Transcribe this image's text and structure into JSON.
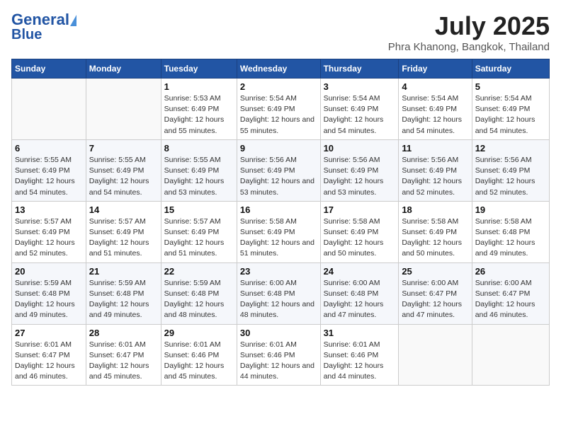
{
  "logo": {
    "line1": "General",
    "line2": "Blue"
  },
  "title": "July 2025",
  "subtitle": "Phra Khanong, Bangkok, Thailand",
  "days_of_week": [
    "Sunday",
    "Monday",
    "Tuesday",
    "Wednesday",
    "Thursday",
    "Friday",
    "Saturday"
  ],
  "weeks": [
    [
      {
        "day": "",
        "info": ""
      },
      {
        "day": "",
        "info": ""
      },
      {
        "day": "1",
        "info": "Sunrise: 5:53 AM\nSunset: 6:49 PM\nDaylight: 12 hours and 55 minutes."
      },
      {
        "day": "2",
        "info": "Sunrise: 5:54 AM\nSunset: 6:49 PM\nDaylight: 12 hours and 55 minutes."
      },
      {
        "day": "3",
        "info": "Sunrise: 5:54 AM\nSunset: 6:49 PM\nDaylight: 12 hours and 54 minutes."
      },
      {
        "day": "4",
        "info": "Sunrise: 5:54 AM\nSunset: 6:49 PM\nDaylight: 12 hours and 54 minutes."
      },
      {
        "day": "5",
        "info": "Sunrise: 5:54 AM\nSunset: 6:49 PM\nDaylight: 12 hours and 54 minutes."
      }
    ],
    [
      {
        "day": "6",
        "info": "Sunrise: 5:55 AM\nSunset: 6:49 PM\nDaylight: 12 hours and 54 minutes."
      },
      {
        "day": "7",
        "info": "Sunrise: 5:55 AM\nSunset: 6:49 PM\nDaylight: 12 hours and 54 minutes."
      },
      {
        "day": "8",
        "info": "Sunrise: 5:55 AM\nSunset: 6:49 PM\nDaylight: 12 hours and 53 minutes."
      },
      {
        "day": "9",
        "info": "Sunrise: 5:56 AM\nSunset: 6:49 PM\nDaylight: 12 hours and 53 minutes."
      },
      {
        "day": "10",
        "info": "Sunrise: 5:56 AM\nSunset: 6:49 PM\nDaylight: 12 hours and 53 minutes."
      },
      {
        "day": "11",
        "info": "Sunrise: 5:56 AM\nSunset: 6:49 PM\nDaylight: 12 hours and 52 minutes."
      },
      {
        "day": "12",
        "info": "Sunrise: 5:56 AM\nSunset: 6:49 PM\nDaylight: 12 hours and 52 minutes."
      }
    ],
    [
      {
        "day": "13",
        "info": "Sunrise: 5:57 AM\nSunset: 6:49 PM\nDaylight: 12 hours and 52 minutes."
      },
      {
        "day": "14",
        "info": "Sunrise: 5:57 AM\nSunset: 6:49 PM\nDaylight: 12 hours and 51 minutes."
      },
      {
        "day": "15",
        "info": "Sunrise: 5:57 AM\nSunset: 6:49 PM\nDaylight: 12 hours and 51 minutes."
      },
      {
        "day": "16",
        "info": "Sunrise: 5:58 AM\nSunset: 6:49 PM\nDaylight: 12 hours and 51 minutes."
      },
      {
        "day": "17",
        "info": "Sunrise: 5:58 AM\nSunset: 6:49 PM\nDaylight: 12 hours and 50 minutes."
      },
      {
        "day": "18",
        "info": "Sunrise: 5:58 AM\nSunset: 6:49 PM\nDaylight: 12 hours and 50 minutes."
      },
      {
        "day": "19",
        "info": "Sunrise: 5:58 AM\nSunset: 6:48 PM\nDaylight: 12 hours and 49 minutes."
      }
    ],
    [
      {
        "day": "20",
        "info": "Sunrise: 5:59 AM\nSunset: 6:48 PM\nDaylight: 12 hours and 49 minutes."
      },
      {
        "day": "21",
        "info": "Sunrise: 5:59 AM\nSunset: 6:48 PM\nDaylight: 12 hours and 49 minutes."
      },
      {
        "day": "22",
        "info": "Sunrise: 5:59 AM\nSunset: 6:48 PM\nDaylight: 12 hours and 48 minutes."
      },
      {
        "day": "23",
        "info": "Sunrise: 6:00 AM\nSunset: 6:48 PM\nDaylight: 12 hours and 48 minutes."
      },
      {
        "day": "24",
        "info": "Sunrise: 6:00 AM\nSunset: 6:48 PM\nDaylight: 12 hours and 47 minutes."
      },
      {
        "day": "25",
        "info": "Sunrise: 6:00 AM\nSunset: 6:47 PM\nDaylight: 12 hours and 47 minutes."
      },
      {
        "day": "26",
        "info": "Sunrise: 6:00 AM\nSunset: 6:47 PM\nDaylight: 12 hours and 46 minutes."
      }
    ],
    [
      {
        "day": "27",
        "info": "Sunrise: 6:01 AM\nSunset: 6:47 PM\nDaylight: 12 hours and 46 minutes."
      },
      {
        "day": "28",
        "info": "Sunrise: 6:01 AM\nSunset: 6:47 PM\nDaylight: 12 hours and 45 minutes."
      },
      {
        "day": "29",
        "info": "Sunrise: 6:01 AM\nSunset: 6:46 PM\nDaylight: 12 hours and 45 minutes."
      },
      {
        "day": "30",
        "info": "Sunrise: 6:01 AM\nSunset: 6:46 PM\nDaylight: 12 hours and 44 minutes."
      },
      {
        "day": "31",
        "info": "Sunrise: 6:01 AM\nSunset: 6:46 PM\nDaylight: 12 hours and 44 minutes."
      },
      {
        "day": "",
        "info": ""
      },
      {
        "day": "",
        "info": ""
      }
    ]
  ]
}
